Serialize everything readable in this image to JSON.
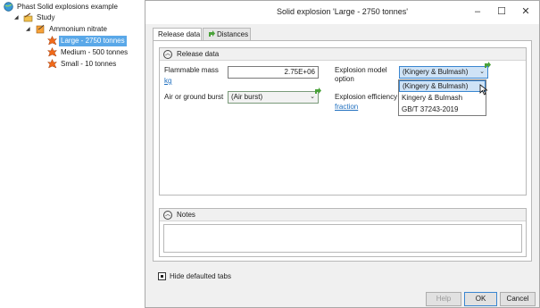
{
  "tree": {
    "root": "Phast Solid explosions example",
    "study": "Study",
    "material": "Ammonium nitrate",
    "items": [
      "Large - 2750 tonnes",
      "Medium - 500 tonnes",
      "Small - 10 tonnes"
    ]
  },
  "dialog": {
    "title": "Solid explosion 'Large - 2750 tonnes'",
    "tabs": [
      "Release data",
      "Distances"
    ],
    "release_group_title": "Release data",
    "flammable_mass_label": "Flammable mass",
    "flammable_mass_unit": "kg",
    "flammable_mass_value": "2.75E+06",
    "burst_label": "Air or ground burst",
    "burst_value": "(Air burst)",
    "explosion_model_label_1": "Explosion model",
    "explosion_model_label_2": "option",
    "explosion_model_value": "(Kingery & Bulmash)",
    "explosion_efficiency_label": "Explosion efficiency",
    "explosion_efficiency_unit": "fraction",
    "dropdown_options": [
      "(Kingery & Bulmash)",
      "Kingery & Bulmash",
      "GB/T 37243-2019"
    ],
    "notes_title": "Notes",
    "hide_defaulted_label": "Hide defaulted tabs",
    "buttons": {
      "help": "Help",
      "ok": "OK",
      "cancel": "Cancel"
    }
  }
}
